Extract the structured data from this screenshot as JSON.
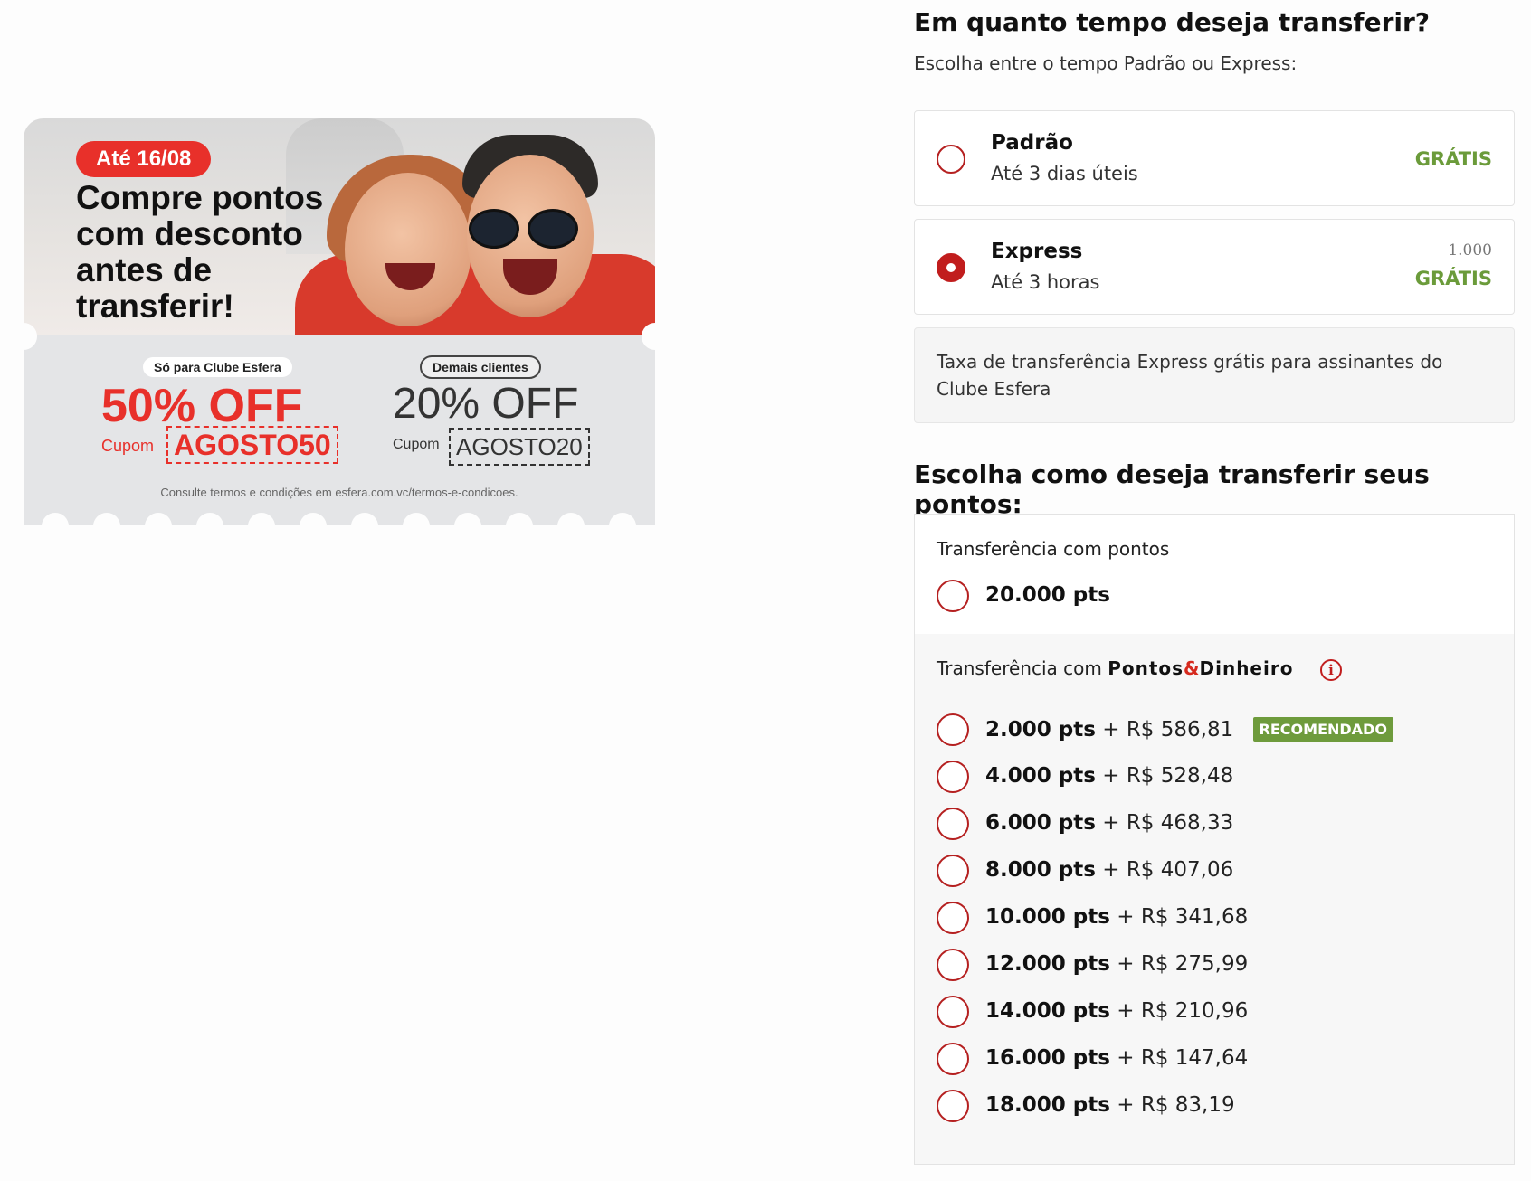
{
  "banner": {
    "date_badge": "Até 16/08",
    "headline": "Compre pontos com desconto antes de transferir!",
    "clube_pill": "Só para Clube Esfera",
    "clube_discount": "50% OFF",
    "clube_cupom_label": "Cupom",
    "clube_code": "AGOSTO50",
    "demais_pill": "Demais clientes",
    "demais_discount": "20% OFF",
    "demais_cupom_label": "Cupom",
    "demais_code": "AGOSTO20",
    "terms": "Consulte termos e condições em esfera.com.vc/termos-e-condicoes."
  },
  "transfer_time": {
    "title": "Em quanto tempo deseja transferir?",
    "subtitle": "Escolha entre o tempo Padrão ou Express:",
    "options": [
      {
        "title": "Padrão",
        "subtitle": "Até 3 dias úteis",
        "old_price": "",
        "price": "GRÁTIS",
        "selected": false
      },
      {
        "title": "Express",
        "subtitle": "Até 3 horas",
        "old_price": "1.000",
        "price": "GRÁTIS",
        "selected": true
      }
    ],
    "note": "Taxa de transferência Express grátis para assinantes do Clube Esfera"
  },
  "payment": {
    "title": "Escolha como deseja transferir seus pontos:",
    "points_label": "Transferência com pontos",
    "points_option": "20.000 pts",
    "mixed_label_prefix": "Transferência com",
    "brand_first": "Pontos",
    "brand_amp": "&",
    "brand_second": "Dinheiro",
    "info_icon": "i",
    "recommended_badge": "RECOMENDADO",
    "mixed_options": [
      {
        "pts": "2.000 pts",
        "money": "+ R$ 586,81",
        "recommended": true
      },
      {
        "pts": "4.000 pts",
        "money": "+ R$ 528,48",
        "recommended": false
      },
      {
        "pts": "6.000 pts",
        "money": "+ R$ 468,33",
        "recommended": false
      },
      {
        "pts": "8.000 pts",
        "money": "+ R$ 407,06",
        "recommended": false
      },
      {
        "pts": "10.000 pts",
        "money": "+ R$ 341,68",
        "recommended": false
      },
      {
        "pts": "12.000 pts",
        "money": "+ R$ 275,99",
        "recommended": false
      },
      {
        "pts": "14.000 pts",
        "money": "+ R$ 210,96",
        "recommended": false
      },
      {
        "pts": "16.000 pts",
        "money": "+ R$ 147,64",
        "recommended": false
      },
      {
        "pts": "18.000 pts",
        "money": "+ R$ 83,19",
        "recommended": false
      }
    ]
  },
  "colors": {
    "brand_red": "#c11d1d",
    "promo_red": "#e8302a",
    "free_green": "#6b9b3a",
    "badge_green": "#6e9b3c"
  }
}
